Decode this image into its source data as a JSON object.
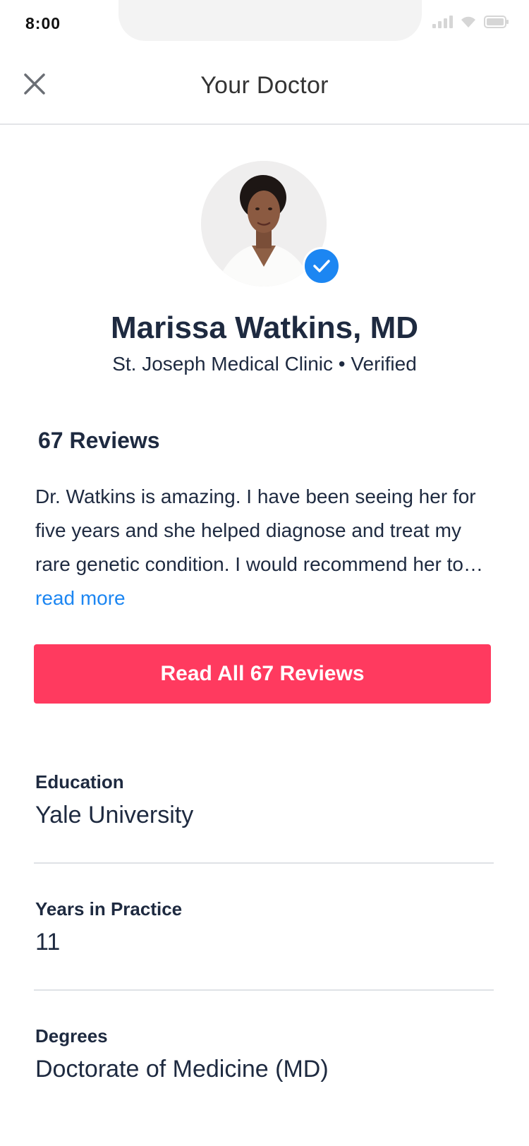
{
  "status_bar": {
    "time": "8:00"
  },
  "header": {
    "title": "Your Doctor",
    "close_icon": "close-icon"
  },
  "doctor": {
    "name": "Marissa Watkins, MD",
    "subtitle": "St. Joseph Medical Clinic • Verified",
    "verified_icon": "checkmark-icon"
  },
  "reviews": {
    "heading": "67 Reviews",
    "excerpt": "Dr. Watkins is amazing. I have been seeing her for five years and she helped diagnose and treat my rare genetic condition. I would recommend her to…",
    "read_more_label": "read more",
    "button_label": "Read All 67 Reviews"
  },
  "info": [
    {
      "label": "Education",
      "value": "Yale University"
    },
    {
      "label": "Years in Practice",
      "value": "11"
    },
    {
      "label": "Degrees",
      "value": "Doctorate of Medicine (MD)"
    }
  ],
  "colors": {
    "accent_button": "#ff3a5f",
    "link_blue": "#1c86f2",
    "text_dark": "#1e2a40",
    "divider": "#dfe2e6"
  }
}
